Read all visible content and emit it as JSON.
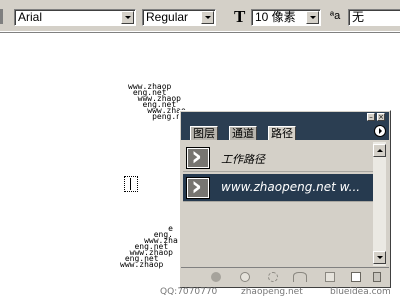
{
  "options_bar": {
    "font_family": "Arial",
    "font_style": "Regular",
    "font_size": "10 像素",
    "anti_alias_label": "ªa",
    "anti_alias": "无"
  },
  "icons": {
    "text_size_icon": "T",
    "anti_alias_icon": "aa"
  },
  "canvas": {
    "art_top": "www.zhaop\n eng.net\n  www.zhaop\n   eng.net\n    www.zhao\n     peng.ne",
    "art_bottom": "          e\n       eng.\n     www.zha\n   eng.net\n  www.zhaop\n eng.net\nwww.zhaop"
  },
  "paths_panel": {
    "tabs": [
      "图层",
      "通道",
      "路径"
    ],
    "active_tab": "路径",
    "paths": [
      {
        "label": "工作路径",
        "selected": false
      },
      {
        "label": "www.zhaopeng.net  w...",
        "selected": true
      }
    ]
  },
  "watermark": {
    "qq": "QQ:7070770",
    "site1": "zhaopeng.net",
    "site2": "blueidea.com"
  },
  "colors": {
    "panel_title": "#2b3e52",
    "selected_row": "#263a4f",
    "chrome": "#d4d0c8"
  }
}
